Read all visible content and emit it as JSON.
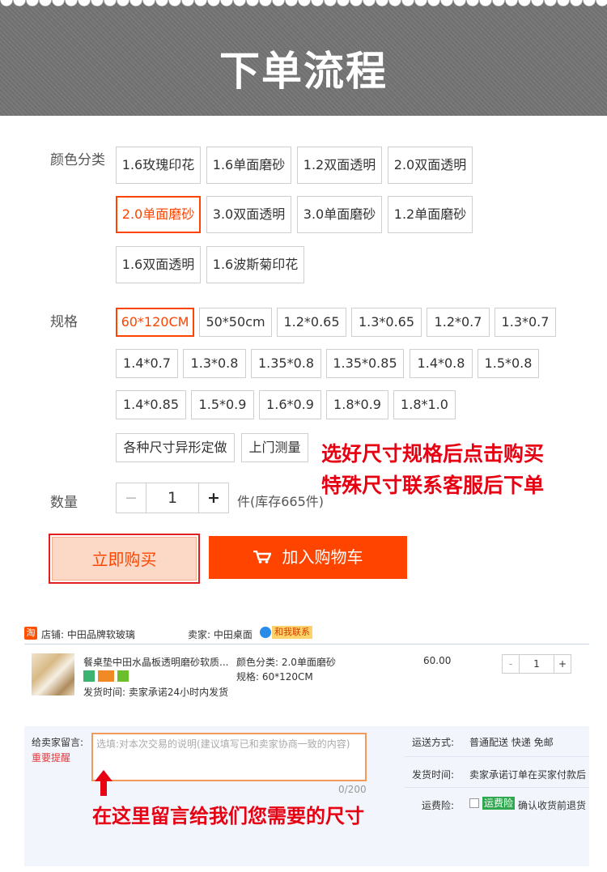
{
  "banner": {
    "title": "下单流程"
  },
  "color": {
    "label": "颜色分类",
    "options": [
      "1.6玫瑰印花",
      "1.6单面磨砂",
      "1.2双面透明",
      "2.0双面透明",
      "2.0单面磨砂",
      "3.0双面透明",
      "3.0单面磨砂",
      "1.2单面磨砂",
      "1.6双面透明",
      "1.6波斯菊印花"
    ],
    "selected": "2.0单面磨砂"
  },
  "size": {
    "label": "规格",
    "options": [
      "60*120CM",
      "50*50cm",
      "1.2*0.65",
      "1.3*0.65",
      "1.2*0.7",
      "1.3*0.7",
      "1.4*0.7",
      "1.3*0.8",
      "1.35*0.8",
      "1.35*0.85",
      "1.4*0.8",
      "1.5*0.8",
      "1.4*0.85",
      "1.5*0.9",
      "1.6*0.9",
      "1.8*0.9",
      "1.8*1.0",
      "各种尺寸异形定做",
      "上门测量"
    ],
    "selected": "60*120CM"
  },
  "notes": {
    "line1": "选好尺寸规格后点击购买",
    "line2": "特殊尺寸联系客服后下单"
  },
  "quantity": {
    "label": "数量",
    "minus": "−",
    "value": "1",
    "plus": "+",
    "stock": "件(库存665件)"
  },
  "buttons": {
    "buy_now": "立即购买",
    "add_cart": "加入购物车"
  },
  "order": {
    "taobao_icon": "淘",
    "shop_label": "店铺: 中田品牌软玻璃",
    "seller_label": "卖家: 中田桌面",
    "contact": "和我联系",
    "item_title": "餐桌垫中田水晶板透明磨砂软质...",
    "ship_time": "发货时间: 卖家承诺24小时内发货",
    "attr_color": "颜色分类: 2.0单面磨砂",
    "attr_size": "规格: 60*120CM",
    "price": "60.00",
    "qty_minus": "-",
    "qty_value": "1",
    "qty_plus": "+",
    "msg_label": "给卖家留言:",
    "important": "重要提醒",
    "msg_placeholder": "选填:对本次交易的说明(建议填写已和卖家协商一致的内容)",
    "msg_counter": "0/200",
    "ship_method_label": "运送方式:",
    "ship_method_value": "普通配送 快递 免邮",
    "deliver_label": "发货时间:",
    "deliver_value": "卖家承诺订单在买家付款后",
    "insurance_label": "运费险:",
    "insurance_tag": "运费险",
    "insurance_text": "确认收货前退货"
  },
  "annotation": "在这里留言给我们您需要的尺寸",
  "colors": {
    "accent": "#ff4400",
    "note_red": "#e60012",
    "banner_grey": "#757575"
  }
}
